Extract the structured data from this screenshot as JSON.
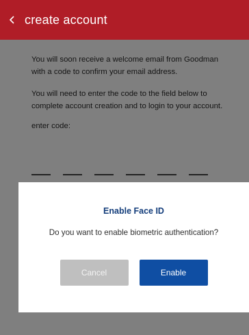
{
  "header": {
    "title": "create account",
    "back_icon": "chevron-left-icon",
    "background": "#b01d27"
  },
  "content": {
    "paragraph1": "You will soon receive a welcome email from Goodman with a code to confirm your email address.",
    "paragraph2": "You will need to enter the code to the field below to complete account creation and to login to your account.",
    "code_label": "enter code:",
    "code_digits": [
      "",
      "",
      "",
      "",
      "",
      ""
    ]
  },
  "dialog": {
    "title": "Enable Face ID",
    "message": "Do you want to enable biometric authentication?",
    "cancel_label": "Cancel",
    "enable_label": "Enable",
    "title_color": "#123c7a",
    "enable_color": "#0f4ea3",
    "cancel_color": "#bfbfbf"
  }
}
